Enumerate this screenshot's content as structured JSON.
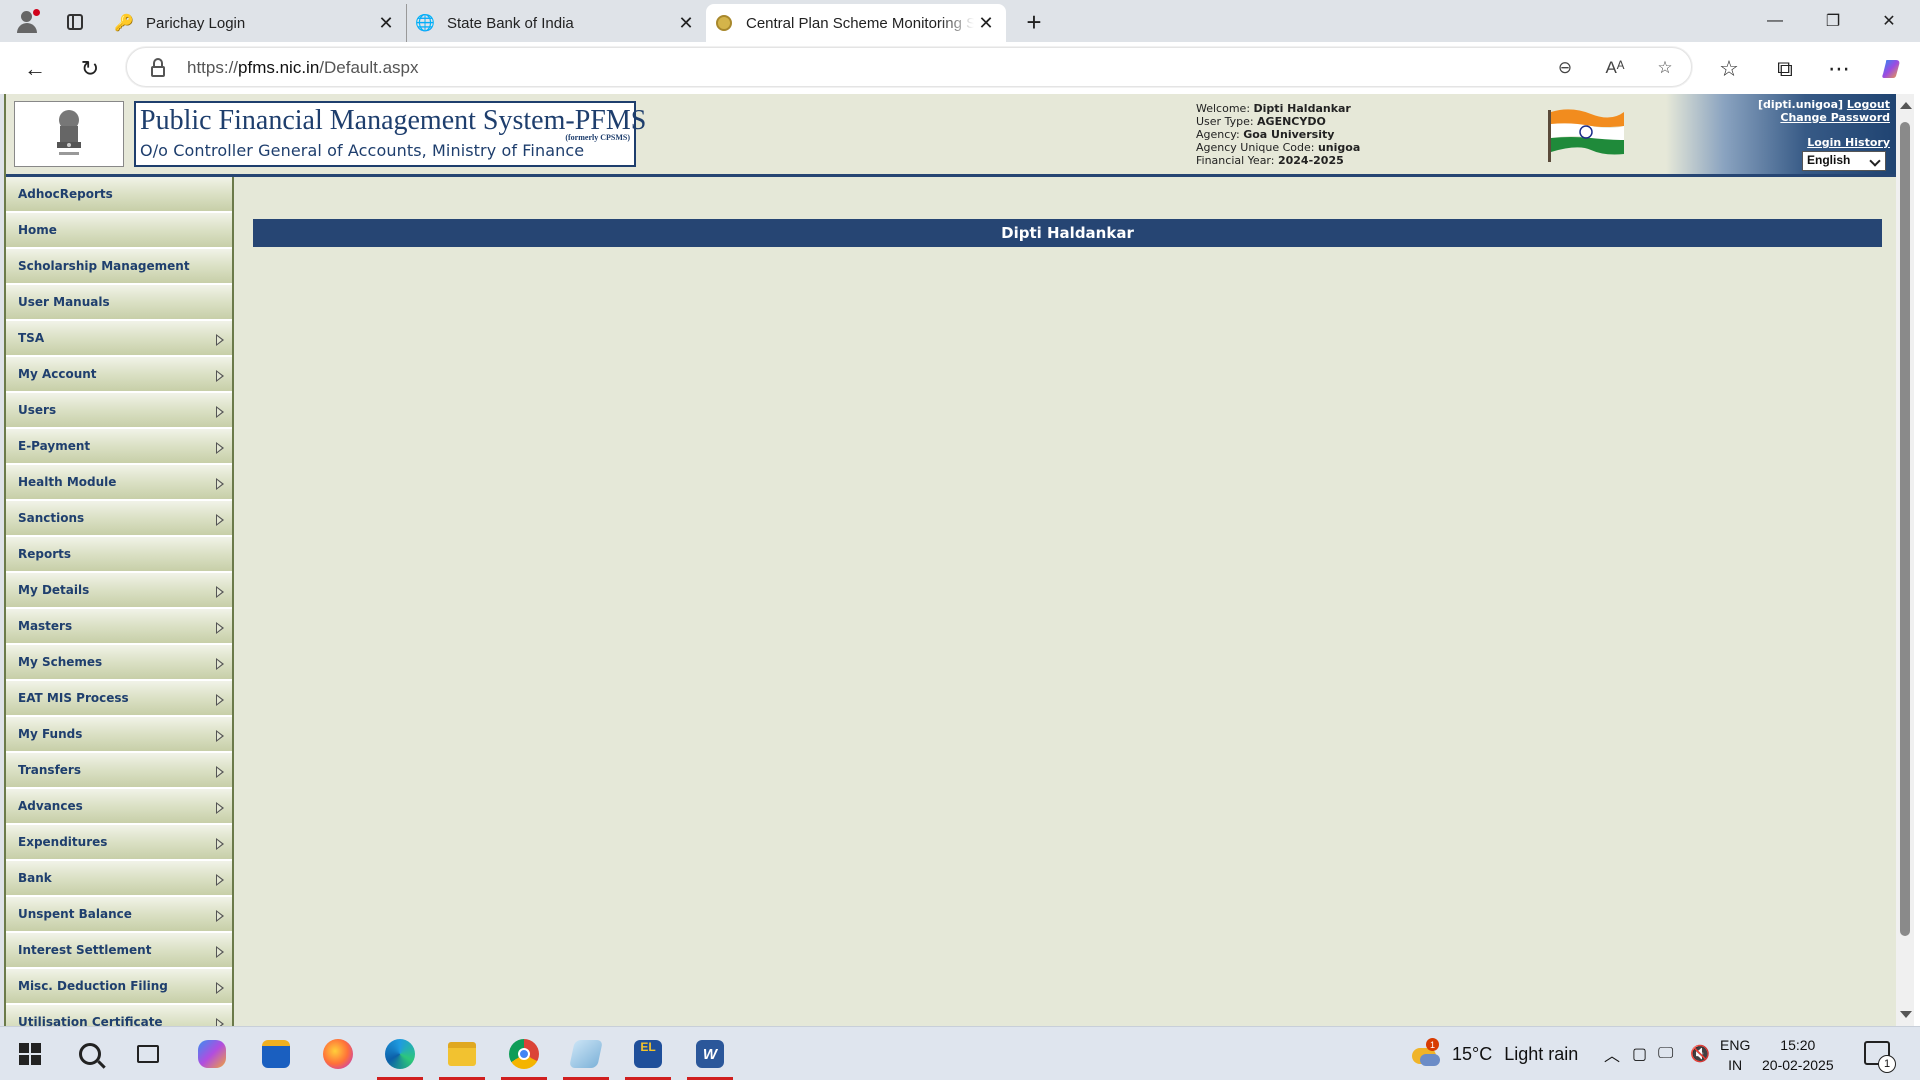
{
  "browser": {
    "tabs": [
      {
        "title": "Parichay Login",
        "icon": "key-icon"
      },
      {
        "title": "State Bank of India",
        "icon": "globe-icon"
      },
      {
        "title": "Central Plan Scheme Monitoring S",
        "icon": "pfms-coin-icon",
        "active": true
      }
    ],
    "url_prefix": "https://",
    "url_host": "pfms.nic.in",
    "url_path": "/Default.aspx"
  },
  "header": {
    "title": "Public Financial Management System-PFMS",
    "subtitle": "O/o Controller General of Accounts, Ministry of Finance",
    "formerly": "(formerly CPSMS)",
    "welcome_label": "Welcome:",
    "welcome_value": "Dipti Haldankar",
    "user_type_label": "User Type:",
    "user_type_value": "AGENCYDO",
    "agency_label": "Agency:",
    "agency_value": "Goa University",
    "agency_code_label": "Agency Unique Code:",
    "agency_code_value": "unigoa",
    "fy_label": "Financial Year:",
    "fy_value": "2024-2025",
    "user_login": "[dipti.unigoa]",
    "logout": "Logout",
    "change_password": "Change Password",
    "login_history": "Login History",
    "language": "English"
  },
  "sidebar": {
    "items": [
      {
        "label": "AdhocReports",
        "submenu": false
      },
      {
        "label": "Home",
        "submenu": false
      },
      {
        "label": "Scholarship Management",
        "submenu": false
      },
      {
        "label": "User Manuals",
        "submenu": false
      },
      {
        "label": "TSA",
        "submenu": true
      },
      {
        "label": "My Account",
        "submenu": true
      },
      {
        "label": "Users",
        "submenu": true
      },
      {
        "label": "E-Payment",
        "submenu": true
      },
      {
        "label": "Health Module",
        "submenu": true
      },
      {
        "label": "Sanctions",
        "submenu": true
      },
      {
        "label": "Reports",
        "submenu": false
      },
      {
        "label": "My Details",
        "submenu": true
      },
      {
        "label": "Masters",
        "submenu": true
      },
      {
        "label": "My Schemes",
        "submenu": true
      },
      {
        "label": "EAT MIS Process",
        "submenu": true
      },
      {
        "label": "My Funds",
        "submenu": true
      },
      {
        "label": "Transfers",
        "submenu": true
      },
      {
        "label": "Advances",
        "submenu": true
      },
      {
        "label": "Expenditures",
        "submenu": true
      },
      {
        "label": "Bank",
        "submenu": true
      },
      {
        "label": "Unspent Balance",
        "submenu": true
      },
      {
        "label": "Interest Settlement",
        "submenu": true
      },
      {
        "label": "Misc. Deduction Filing",
        "submenu": true
      },
      {
        "label": "Utilisation Certificate",
        "submenu": true
      }
    ]
  },
  "main": {
    "user_banner": "Dipti Haldankar"
  },
  "taskbar": {
    "weather_temp": "15°C",
    "weather_desc": "Light rain",
    "weather_badge": "1",
    "lang_top": "ENG",
    "lang_bottom": "IN",
    "time": "15:20",
    "date": "20-02-2025",
    "notification_count": "1"
  }
}
